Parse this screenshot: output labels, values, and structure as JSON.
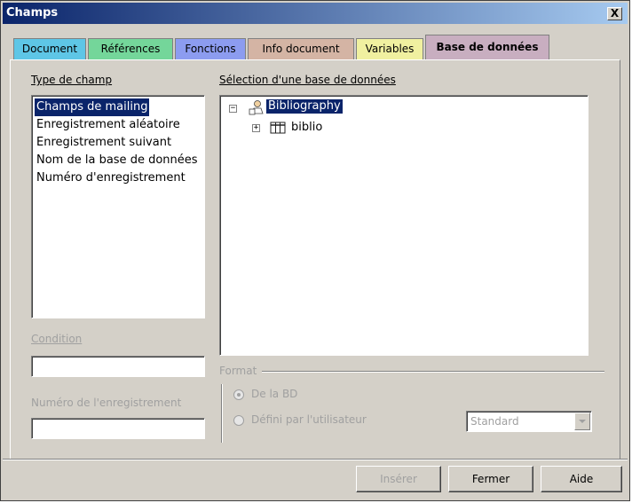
{
  "window": {
    "title": "Champs",
    "close_label": "X"
  },
  "tabs": [
    {
      "label": "Document",
      "color": "#5ec6e6"
    },
    {
      "label": "Références",
      "color": "#74d69a"
    },
    {
      "label": "Fonctions",
      "color": "#8c9cf0"
    },
    {
      "label": "Info document",
      "color": "#d4b4a4"
    },
    {
      "label": "Variables",
      "color": "#f0f0a0"
    },
    {
      "label": "Base de données",
      "color": "#c8aec0",
      "active": true
    }
  ],
  "type_de_champ": {
    "label": "Type de champ",
    "items": [
      {
        "label": "Champs de mailing",
        "selected": true
      },
      {
        "label": "Enregistrement aléatoire"
      },
      {
        "label": "Enregistrement suivant"
      },
      {
        "label": "Nom de la base de données"
      },
      {
        "label": "Numéro d'enregistrement"
      }
    ]
  },
  "database": {
    "label": "Sélection d'une base de données",
    "tree": [
      {
        "label": "Bibliography",
        "expander": "−",
        "selected": true,
        "icon": "database-icon"
      },
      {
        "label": "biblio",
        "expander": "+",
        "icon": "table-icon"
      }
    ]
  },
  "condition": {
    "label": "Condition",
    "value": ""
  },
  "record_number": {
    "label": "Numéro de l'enregistrement",
    "value": ""
  },
  "format": {
    "label": "Format",
    "options": [
      {
        "label": "De la BD",
        "checked": true
      },
      {
        "label": "Défini par l'utilisateur",
        "checked": false
      }
    ],
    "select_value": "Standard"
  },
  "buttons": {
    "insert": "Insérer",
    "close": "Fermer",
    "help": "Aide"
  }
}
